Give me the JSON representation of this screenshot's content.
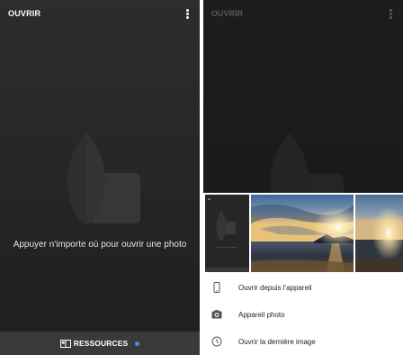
{
  "left_screen": {
    "toolbar_title": "OUVRIR",
    "overflow_icon": "more-vert-icon",
    "logo_icon": "snapseed-leaf-logo",
    "prompt_text": "Appuyer n'importe où pour ouvrir une photo",
    "bottom_bar": {
      "icon": "resources-icon",
      "label": "RESSOURCES",
      "notification_dot_color": "#4a8df0"
    }
  },
  "right_screen": {
    "toolbar_title": "OUVRIR",
    "overflow_icon": "more-vert-icon",
    "thumbnails": [
      {
        "name": "screenshot-thumbnail"
      },
      {
        "name": "sunset-beach-photo"
      },
      {
        "name": "sunset-photo-partial"
      }
    ],
    "menu": [
      {
        "icon": "phone-icon",
        "label": "Ouvrir depuis l'appareil"
      },
      {
        "icon": "camera-icon",
        "label": "Appareil photo"
      },
      {
        "icon": "clock-icon",
        "label": "Ouvrir la dernière image"
      }
    ]
  },
  "colors": {
    "dark_background": "#262626",
    "bottom_bar": "#3a3a3a",
    "accent_blue": "#4a8df0"
  }
}
